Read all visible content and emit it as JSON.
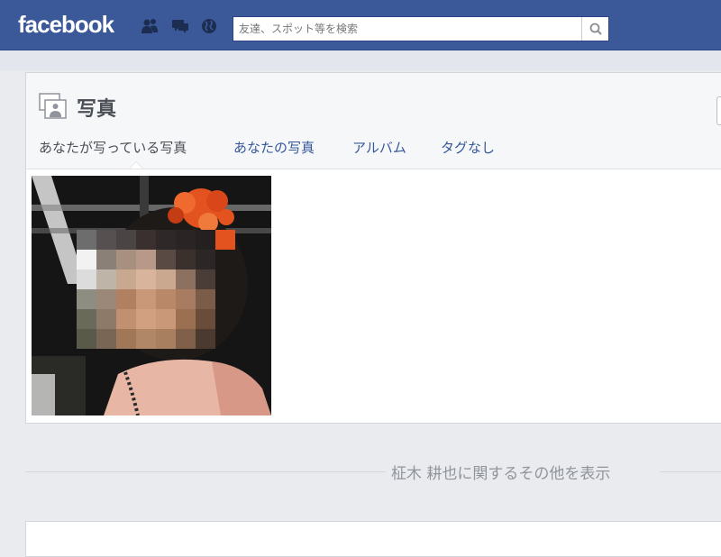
{
  "header": {
    "logo": "facebook",
    "search": {
      "placeholder": "友達、スポット等を検索"
    },
    "icons": [
      "friend-requests-icon",
      "messages-icon",
      "notifications-globe-icon",
      "search-icon"
    ]
  },
  "photos_section": {
    "title": "写真",
    "title_icon": "photos-icon",
    "tabs": [
      {
        "label": "あなたが写っている写真",
        "active": true
      },
      {
        "label": "あなたの写真"
      },
      {
        "label": "アルバム"
      },
      {
        "label": "タグなし"
      }
    ]
  },
  "see_more": {
    "label": "柾木 耕也に関するその他を表示"
  },
  "colors": {
    "brand_blue": "#3b5998",
    "background": "#e9ebee",
    "link": "#365899",
    "muted": "#90949c"
  }
}
